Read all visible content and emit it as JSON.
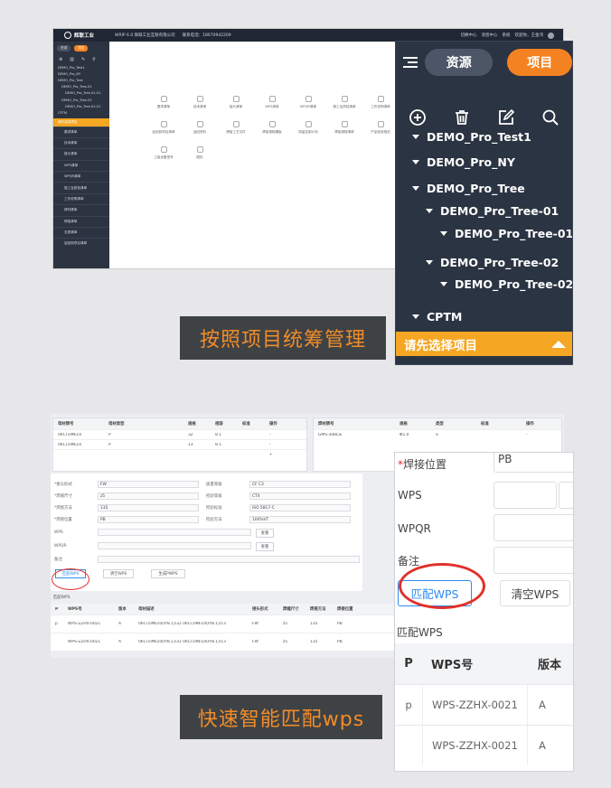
{
  "header": {
    "brand": "辉联工业",
    "system_title": "WRIP 6.0 辉联工业互联有限公司",
    "contact": "联系电话：18670942209",
    "user_items": [
      "切换中心",
      "消息中心",
      "系统",
      "欢迎你，王金鸿"
    ]
  },
  "sidebar_small": {
    "tabs": [
      "资源",
      "项目"
    ],
    "tree": [
      "DEMO_Pro_Test1",
      "DEMO_Pro_NY",
      "DEMO_Pro_Tree",
      "DEMO_Pro_Tree-01",
      "DEMO_Pro_Tree-01-01",
      "DEMO_Pro_Tree-02",
      "DEMO_Pro_Tree-02-01",
      "CPTM"
    ],
    "select_prompt": "请先选择项目",
    "menu": [
      "要求清单",
      "技术清单",
      "接头清单",
      "WPS清单",
      "WPQR清单",
      "施工及质检清单",
      "工作说明清单",
      "焊材清单",
      "焊接清单",
      "无损清单",
      "返回到项目清单"
    ]
  },
  "module_grid": [
    "要求清单",
    "技术清单",
    "接头清单",
    "WPS清单",
    "WPQR清单",
    "施工及质检清单",
    "工作说明清单",
    "焊材清单",
    "返回到项目清单",
    "返回资料",
    "焊接工艺文件",
    "焊接规程模板",
    "质量控制计划",
    "焊接规程清单",
    "产品检验规范",
    "",
    "工装设备型号",
    "图形"
  ],
  "zoom_sidebar": {
    "tab_resource": "资源",
    "tab_project": "项目",
    "tree": [
      {
        "label": "DEMO_Pro_Test1",
        "level": 0
      },
      {
        "label": "DEMO_Pro_NY",
        "level": 0
      },
      {
        "label": "DEMO_Pro_Tree",
        "level": 0
      },
      {
        "label": "DEMO_Pro_Tree-01",
        "level": 1
      },
      {
        "label": "DEMO_Pro_Tree-01-01",
        "level": 2
      },
      {
        "label": "DEMO_Pro_Tree-02",
        "level": 1
      },
      {
        "label": "DEMO_Pro_Tree-02-01",
        "level": 2
      },
      {
        "label": "CPTM",
        "level": 0
      }
    ],
    "select_prompt": "请先选择项目"
  },
  "captions": {
    "top": "按照项目统筹管理",
    "bottom": "快速智能匹配wps"
  },
  "wps_screen": {
    "material_table": {
      "headers": [
        "母材牌号",
        "母材类型",
        "规格",
        "相容",
        "标准",
        "操作"
      ],
      "rows": [
        [
          "06Cr19Ni10",
          "P",
          "32",
          "8.1",
          "",
          "-"
        ],
        [
          "06Cr19Ni10",
          "P",
          "13",
          "8.1",
          "",
          "-"
        ]
      ],
      "add_symbol": "+"
    },
    "filler_table": {
      "headers": [
        "焊材牌号",
        "规格",
        "类型",
        "标准",
        "操作"
      ],
      "rows": [
        [
          "GMS-308LSi",
          "Φ1.0",
          "S",
          "",
          "-"
        ]
      ]
    },
    "form": {
      "joint_type_label": "*接头形式",
      "joint_type": "FW",
      "weld_size_label": "*焊缝尺寸",
      "weld_size": "z5",
      "weld_method_label": "*焊接方法",
      "weld_method": "135",
      "position_label": "*焊接位置",
      "position": "PB",
      "wps_label": "WPS",
      "wpqr_label": "WPQR",
      "remark_label": "备注",
      "quality_label": "质量等级",
      "quality": "CF C3",
      "grade_label": "检验等级",
      "grade": "CT4",
      "std_label": "检验标准",
      "std": "ISO 5817-C",
      "method_label": "检验方法",
      "method": "100%VT",
      "lookup_label": "查看"
    },
    "buttons": {
      "match": "匹配WPS",
      "clear": "清空WPS",
      "generate": "生成PWPS"
    },
    "result_title": "匹配WPS",
    "result_headers": [
      "P",
      "WPS号",
      "版本",
      "母材描述",
      "接头形式",
      "焊缝尺寸",
      "焊接方法",
      "焊接位置"
    ],
    "result_rows": [
      [
        "p",
        "WPS-ZZHX-0021",
        "A",
        "06Cr19Ni10(P/8.1)/32 06Cr19Ni10(P/8.1)/13",
        "FW",
        "z5",
        "135",
        "PB"
      ],
      [
        "",
        "WPS-ZZHX-0021",
        "A",
        "06Cr19Ni10(P/8.1)/32 06Cr19Ni10(P/8.1)/13",
        "FW",
        "z5",
        "135",
        "PB"
      ]
    ]
  },
  "zoom_wps": {
    "position_label": "焊接位置",
    "position_required_mark": "*",
    "position_value": "PB",
    "wps_label": "WPS",
    "wpqr_label": "WPQR",
    "remark_label": "备注",
    "match_button": "匹配WPS",
    "clear_button": "清空WPS",
    "section_title": "匹配WPS",
    "headers": [
      "P",
      "WPS号",
      "版本"
    ],
    "rows": [
      [
        "p",
        "WPS-ZZHX-0021",
        "A"
      ],
      [
        "",
        "WPS-ZZHX-0021",
        "A"
      ]
    ]
  }
}
